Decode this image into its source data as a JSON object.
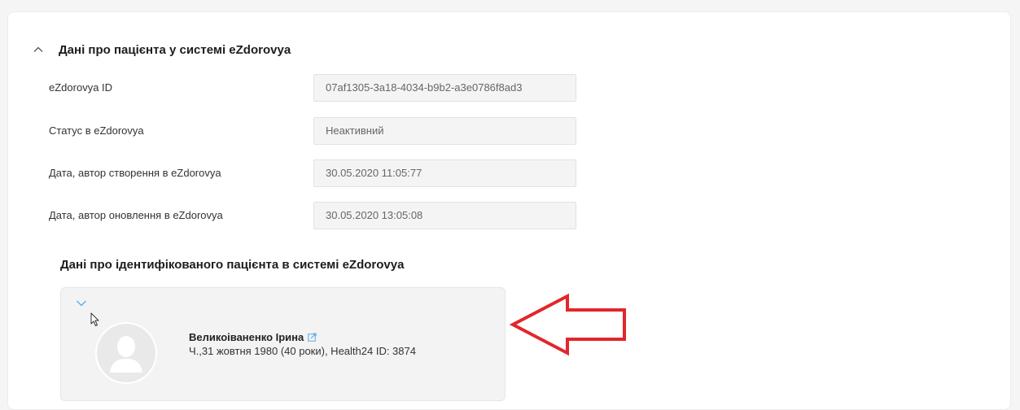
{
  "section": {
    "title": "Дані про пацієнта у системі eZdorovya",
    "fields": [
      {
        "label": "eZdorovya ID",
        "value": "07af1305-3a18-4034-b9b2-a3e0786f8ad3"
      },
      {
        "label": "Статус в eZdorovya",
        "value": "Неактивний"
      },
      {
        "label": "Дата, автор створення в eZdorovya",
        "value": "30.05.2020 11:05:77"
      },
      {
        "label": "Дата, автор оновлення в eZdorovya",
        "value": "30.05.2020 13:05:08"
      }
    ]
  },
  "identified": {
    "title": "Дані про ідентифікованого пацієнта в системі eZdorovya",
    "patient": {
      "name": "Великоіваненко Ірина",
      "info": "Ч.,31 жовтня 1980 (40 роки), Health24 ID: 3874"
    }
  },
  "icons": {
    "collapse": "chevron-up-icon",
    "expand": "chevron-down-icon",
    "edit": "external-edit-icon",
    "avatar": "user-placeholder-icon",
    "cursor": "mouse-pointer-icon",
    "annotation": "red-arrow-icon"
  },
  "colors": {
    "accent": "#5aa9e6",
    "annotation": "#e3262b",
    "field_bg": "#f4f4f4",
    "card_bg": "#f3f3f3"
  }
}
